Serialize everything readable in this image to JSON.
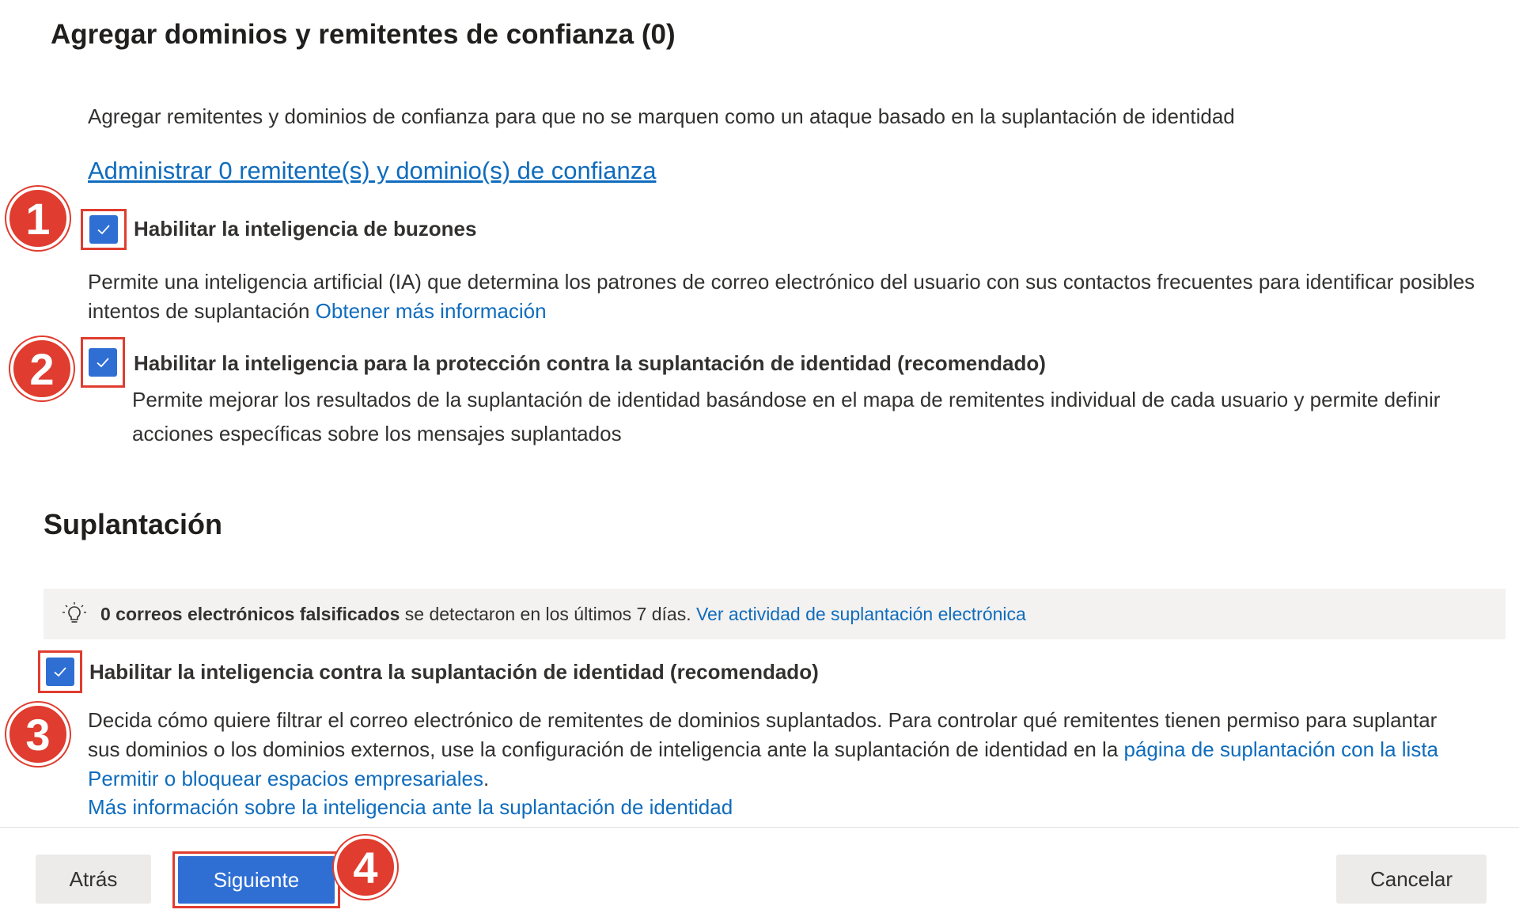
{
  "trusted": {
    "title": "Agregar dominios y remitentes de confianza (0)",
    "intro": "Agregar remitentes y dominios de confianza para que no se marquen como un ataque basado en la suplantación de identidad",
    "manage_link": "Administrar 0 remitente(s) y dominio(s) de confianza"
  },
  "mailbox_intelligence": {
    "checked": true,
    "label": "Habilitar la inteligencia de buzones",
    "desc": "Permite una inteligencia artificial (IA) que determina los patrones de correo electrónico del usuario con sus contactos frecuentes para identificar posibles intentos de suplantación",
    "link": "Obtener más información"
  },
  "impersonation_protection": {
    "checked": true,
    "label": "Habilitar la inteligencia para la protección contra la suplantación de identidad (recomendado)",
    "desc": "Permite mejorar los resultados de la suplantación de identidad basándose en el mapa de remitentes individual de cada usuario y permite definir acciones específicas sobre los mensajes suplantados"
  },
  "spoof": {
    "title": "Suplantación",
    "info_bold": "0 correos electrónicos falsificados",
    "info_text": " se detectaron en los últimos 7 días. ",
    "info_link": "Ver actividad de suplantación electrónica",
    "checkbox_checked": true,
    "checkbox_label": "Habilitar la inteligencia contra la suplantación de identidad (recomendado)",
    "desc": "Decida cómo quiere filtrar el correo electrónico de remitentes de dominios suplantados. Para controlar qué remitentes tienen permiso para suplantar sus dominios o los dominios externos, use la configuración de inteligencia ante la suplantación de identidad en la ",
    "desc_link": "página de suplantación con la lista Permitir o bloquear espacios empresariales",
    "desc_end": ".",
    "more_link": "Más información sobre la inteligencia ante la suplantación de identidad"
  },
  "badges": [
    "1",
    "2",
    "3",
    "4"
  ],
  "footer": {
    "back": "Atrás",
    "next": "Siguiente",
    "cancel": "Cancelar"
  },
  "colors": {
    "accent": "#2f6fd4",
    "link": "#0f6cbd",
    "annotation": "#e03c2f"
  }
}
